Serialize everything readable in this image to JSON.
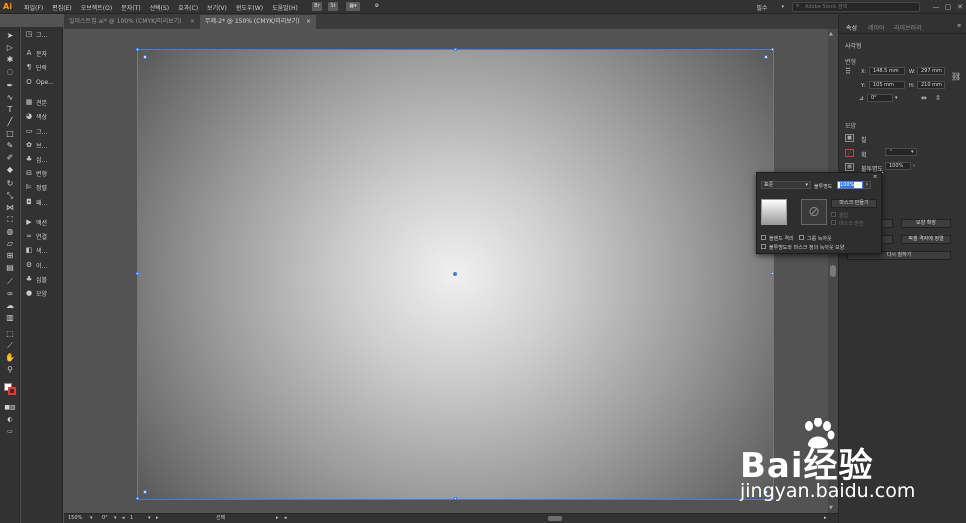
{
  "app": {
    "logo": "Ai",
    "workspace": "필수",
    "stock_search_placeholder": "Adobe Stock 검색"
  },
  "menu": {
    "items": [
      "파일(F)",
      "편집(E)",
      "오브젝트(O)",
      "문자(T)",
      "선택(S)",
      "효과(C)",
      "보기(V)",
      "윈도우(W)",
      "도움말(H)"
    ],
    "icons": [
      "Br",
      "St"
    ]
  },
  "window": {
    "minimize": "—",
    "maximize": "▢",
    "close": "✕"
  },
  "doc_tabs": [
    {
      "label": "일러스트집.ai* @ 100% (CMYK/미리보기)",
      "close": "×"
    },
    {
      "label": "무제-2* @ 150% (CMYK/미리보기)",
      "close": "×"
    }
  ],
  "tools": {
    "icons": [
      "selection-tool",
      "direct-selection-tool",
      "magic-wand-tool",
      "lasso-tool",
      "pen-tool",
      "curvature-tool",
      "type-tool",
      "line-tool",
      "rectangle-tool",
      "paintbrush-tool",
      "shaper-tool",
      "eraser-tool",
      "rotate-tool",
      "scale-tool",
      "width-tool",
      "free-transform-tool",
      "shape-builder-tool",
      "perspective-grid-tool",
      "mesh-tool",
      "gradient-tool",
      "eyedropper-tool",
      "blend-tool",
      "symbol-sprayer-tool",
      "column-graph-tool",
      "artboard-tool",
      "slice-tool",
      "hand-tool",
      "zoom-tool",
      "fill-stroke-swatch",
      "color-mode",
      "draw-mode",
      "screen-mode"
    ]
  },
  "left_panel": {
    "items": [
      {
        "icon": "transform-icon",
        "label": "그..."
      },
      {
        "icon": "character-icon",
        "label": "문자"
      },
      {
        "icon": "paragraph-icon",
        "label": "단락"
      },
      {
        "icon": "opentype-icon",
        "label": "Ope..."
      },
      {
        "icon": "swatches-icon",
        "label": "견본"
      },
      {
        "icon": "color-icon",
        "label": "색상"
      },
      {
        "icon": "gradient-icon",
        "label": "그..."
      },
      {
        "icon": "brushes-icon",
        "label": "브..."
      },
      {
        "icon": "symbols-icon",
        "label": "심..."
      },
      {
        "icon": "transform-panel-icon",
        "label": "변형"
      },
      {
        "icon": "align-icon",
        "label": "정렬"
      },
      {
        "icon": "pathfinder-icon",
        "label": "패..."
      },
      {
        "icon": "actions-icon",
        "label": "액션"
      },
      {
        "icon": "links-icon",
        "label": "연결"
      },
      {
        "icon": "color-guide-icon",
        "label": "색..."
      },
      {
        "icon": "image-trace-icon",
        "label": "이..."
      },
      {
        "icon": "symbol-icon",
        "label": "심볼"
      },
      {
        "icon": "appearance-icon",
        "label": "모양"
      }
    ]
  },
  "right_panel": {
    "tabs": [
      "속성",
      "레이어",
      "라이브러리"
    ],
    "object_type": "사각형",
    "transform": {
      "title": "변형",
      "x_label": "X:",
      "x": "148.5 mm",
      "w_label": "W:",
      "w": "297 mm",
      "y_label": "Y:",
      "y": "105 mm",
      "h_label": "H:",
      "h": "210 mm",
      "angle_label": "⊿",
      "angle": "0°"
    },
    "appearance": {
      "title": "모양",
      "fill_label": "칠",
      "stroke_label": "획",
      "opacity_label": "불투명도",
      "opacity": "100%"
    },
    "actions": {
      "offset_path": "...셔",
      "expand_appearance": "모양 확장",
      "arrange": "...",
      "align_to_grid": "픽셀 격자에 정렬",
      "recolor": "다시 칠하기"
    }
  },
  "transparency_popup": {
    "blend_mode": "표준",
    "opacity_label": "불투명도",
    "opacity_value": "100%",
    "make_mask": "마스크 만들기",
    "clip": "클립",
    "invert_mask": "마스크 반전",
    "isolate_blending": "블렌드 격리",
    "knockout_group": "그룹 녹아웃",
    "opacity_mask_knockout": "불투명도와 마스크 정의 녹아웃 모양"
  },
  "status": {
    "zoom": "150%",
    "angle": "0°",
    "artboard": "1",
    "tool": "선택"
  },
  "watermark": {
    "brand": "Bai经验",
    "url": "jingyan.baidu.com"
  },
  "colors": {
    "accent": "#4a7bdc",
    "panel": "#323232",
    "canvas": "#535353"
  }
}
